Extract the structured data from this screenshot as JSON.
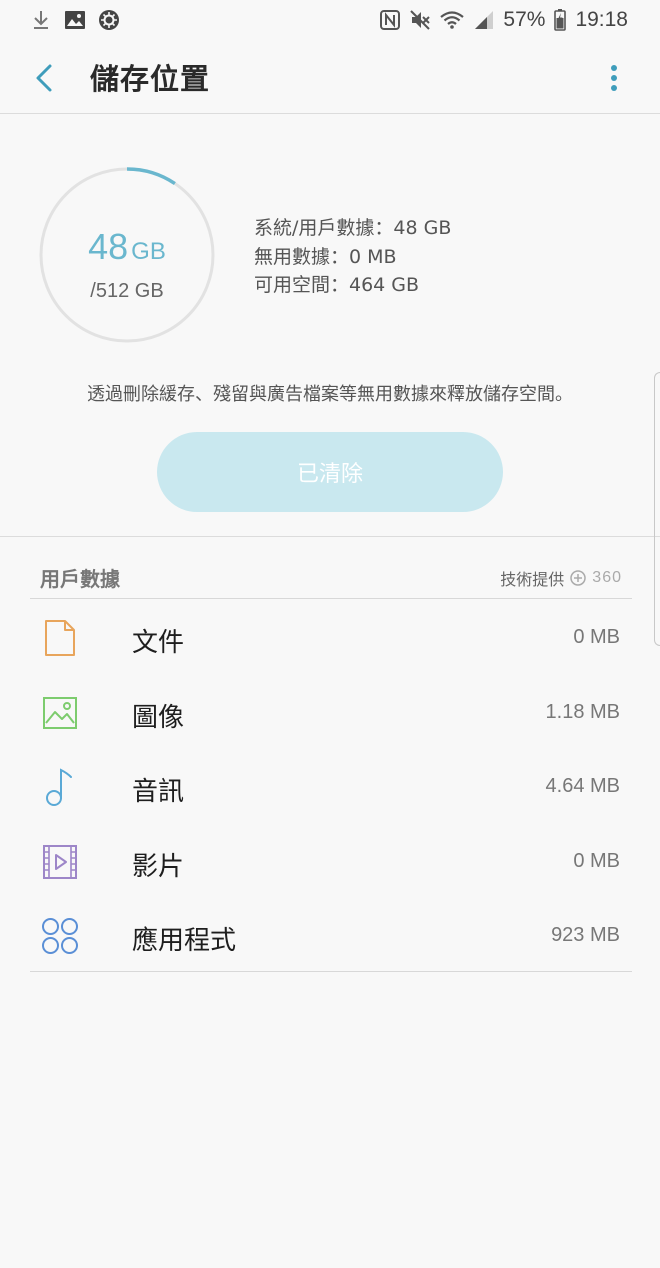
{
  "status_bar": {
    "battery": "57%",
    "time": "19:18"
  },
  "header": {
    "title": "儲存位置"
  },
  "storage": {
    "used_value": "48",
    "used_unit": "GB",
    "total": "/512 GB",
    "used_fraction": 0.094,
    "details": {
      "system_user_data": "系統/用戶數據：48 GB",
      "junk_data": "無用數據：0 MB",
      "available": "可用空間：464 GB"
    },
    "hint": "透過刪除緩存、殘留與廣告檔案等無用數據來釋放儲存空間。",
    "clean_button_label": "已清除"
  },
  "user_data": {
    "section_title": "用戶數據",
    "provider_label": "技術提供",
    "provider_logo": "360",
    "categories": [
      {
        "label": "文件",
        "size": "0 MB",
        "icon": "document-icon",
        "color": "#e8a55c"
      },
      {
        "label": "圖像",
        "size": "1.18 MB",
        "icon": "image-icon",
        "color": "#7dcc6e"
      },
      {
        "label": "音訊",
        "size": "4.64 MB",
        "icon": "music-note-icon",
        "color": "#5aa9d6"
      },
      {
        "label": "影片",
        "size": "0 MB",
        "icon": "video-icon",
        "color": "#9d86c8"
      },
      {
        "label": "應用程式",
        "size": "923 MB",
        "icon": "apps-icon",
        "color": "#5a8fd6"
      }
    ]
  },
  "colors": {
    "accent": "#6ab7ce",
    "ring_track": "#e2e2e2",
    "button_disabled": "#c9e8ef",
    "background": "#f8f8f8"
  }
}
